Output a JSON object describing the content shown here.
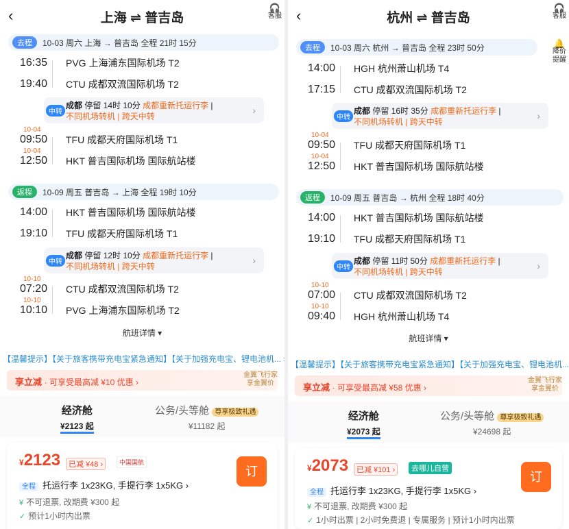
{
  "left": {
    "title": "上海 ⇌ 普吉岛",
    "service": "客服",
    "outbound": {
      "tag": "去程",
      "info": "10-03 周六   上海 → 普吉岛   全程 21时 15分"
    },
    "out_f1": [
      {
        "t": "16:35",
        "ap": "PVG 上海浦东国际机场 T2"
      },
      {
        "t": "19:40",
        "ap": "CTU 成都双流国际机场 T2"
      }
    ],
    "out_tr": {
      "tag": "中转",
      "city": "成都",
      "stay": "停留 14时 10分",
      "recheck": "成都重新托运行李",
      "l2": "不同机场转机 | 跨天中转"
    },
    "out_f2": [
      {
        "nd": "10-04",
        "t": "09:50",
        "ap": "TFU 成都天府国际机场 T1"
      },
      {
        "nd": "10-04",
        "t": "12:50",
        "ap": "HKT 普吉国际机场 国际航站楼"
      }
    ],
    "ret": {
      "tag": "返程",
      "info": "10-09 周五   普吉岛 → 上海   全程 19时 10分"
    },
    "ret_f1": [
      {
        "t": "14:00",
        "ap": "HKT 普吉国际机场 国际航站楼"
      },
      {
        "t": "19:10",
        "ap": "TFU 成都天府国际机场 T1"
      }
    ],
    "ret_tr": {
      "tag": "中转",
      "city": "成都",
      "stay": "停留 12时 10分",
      "recheck": "成都重新托运行李",
      "l2": "不同机场转机 | 跨天中转"
    },
    "ret_f2": [
      {
        "nd": "10-10",
        "t": "07:20",
        "ap": "CTU 成都双流国际机场 T2"
      },
      {
        "nd": "10-10",
        "t": "10:10",
        "ap": "PVG 上海浦东国际机场 T2"
      }
    ],
    "detail": "航班详情 ▾",
    "notice": "【温馨提示】【关于旅客携带充电宝紧急通知】【关于加强充电宝、锂电池机... ›",
    "promo": {
      "main": "享立减",
      "sub": "· 可享受最高减 ¥10 优惠  ›",
      "r1": "金翼飞行家",
      "r2": "享金翼价"
    },
    "cabins": {
      "eco": "经济舱",
      "eco_price": "¥2123 起",
      "biz": "公务/头等舱",
      "vip": "尊享极致礼遇",
      "biz_price": "¥11182 起"
    },
    "card": {
      "price": "2123",
      "disc": "已减 ¥48 ›",
      "airline": "中国国航",
      "book": "订",
      "qc": "全程",
      "bag": "托运行李 1x23KG, 手提行李 1x5KG ›",
      "rule": "不可退票, 改期费 ¥300 起",
      "ticket": "预计1小时内出票"
    }
  },
  "right": {
    "title": "杭州 ⇌ 普吉岛",
    "service": "客服",
    "pricedrop": "降价提醒",
    "outbound": {
      "tag": "去程",
      "info": "10-03 周六   杭州 → 普吉岛   全程 23时 50分"
    },
    "out_f1": [
      {
        "t": "14:00",
        "ap": "HGH 杭州萧山机场 T4"
      },
      {
        "t": "17:15",
        "ap": "CTU 成都双流国际机场 T2"
      }
    ],
    "out_tr": {
      "tag": "中转",
      "city": "成都",
      "stay": "停留 16时 35分",
      "recheck": "成都重新托运行李",
      "l2": "不同机场转机 | 跨天中转"
    },
    "out_f2": [
      {
        "nd": "10-04",
        "t": "09:50",
        "ap": "TFU 成都天府国际机场 T1"
      },
      {
        "nd": "10-04",
        "t": "12:50",
        "ap": "HKT 普吉国际机场 国际航站楼"
      }
    ],
    "ret": {
      "tag": "返程",
      "info": "10-09 周五   普吉岛 → 杭州   全程 18时 40分"
    },
    "ret_f1": [
      {
        "t": "14:00",
        "ap": "HKT 普吉国际机场 国际航站楼"
      },
      {
        "t": "19:10",
        "ap": "TFU 成都天府国际机场 T1"
      }
    ],
    "ret_tr": {
      "tag": "中转",
      "city": "成都",
      "stay": "停留 11时 50分",
      "recheck": "成都重新托运行李",
      "l2": "不同机场转机 | 跨天中转"
    },
    "ret_f2": [
      {
        "nd": "10-10",
        "t": "07:00",
        "ap": "CTU 成都双流国际机场 T2"
      },
      {
        "nd": "10-10",
        "t": "09:40",
        "ap": "HGH 杭州萧山机场 T4"
      }
    ],
    "detail": "航班详情 ▾",
    "notice": "【温馨提示】【关于旅客携带充电宝紧急通知】【关于加强充电宝、锂电池机... ›",
    "promo": {
      "main": "享立减",
      "sub": "· 可享受最高减 ¥58 优惠  ›",
      "r1": "金翼飞行家",
      "r2": "享金翼价"
    },
    "cabins": {
      "eco": "经济舱",
      "eco_price": "¥2073 起",
      "biz": "公务/头等舱",
      "vip": "尊享极致礼遇",
      "biz_price": "¥24698 起"
    },
    "card": {
      "price": "2073",
      "disc": "已减 ¥101 ›",
      "selfop": "去哪儿自营",
      "book": "订",
      "qc": "全程",
      "bag": "托运行李 1x23KG, 手提行李 1x5KG ›",
      "rule": "不可退票, 改期费 ¥300 起",
      "ticket": "1小时出票 | 2小时免费退 | 专属服务 | 预计1小时内出票"
    }
  }
}
